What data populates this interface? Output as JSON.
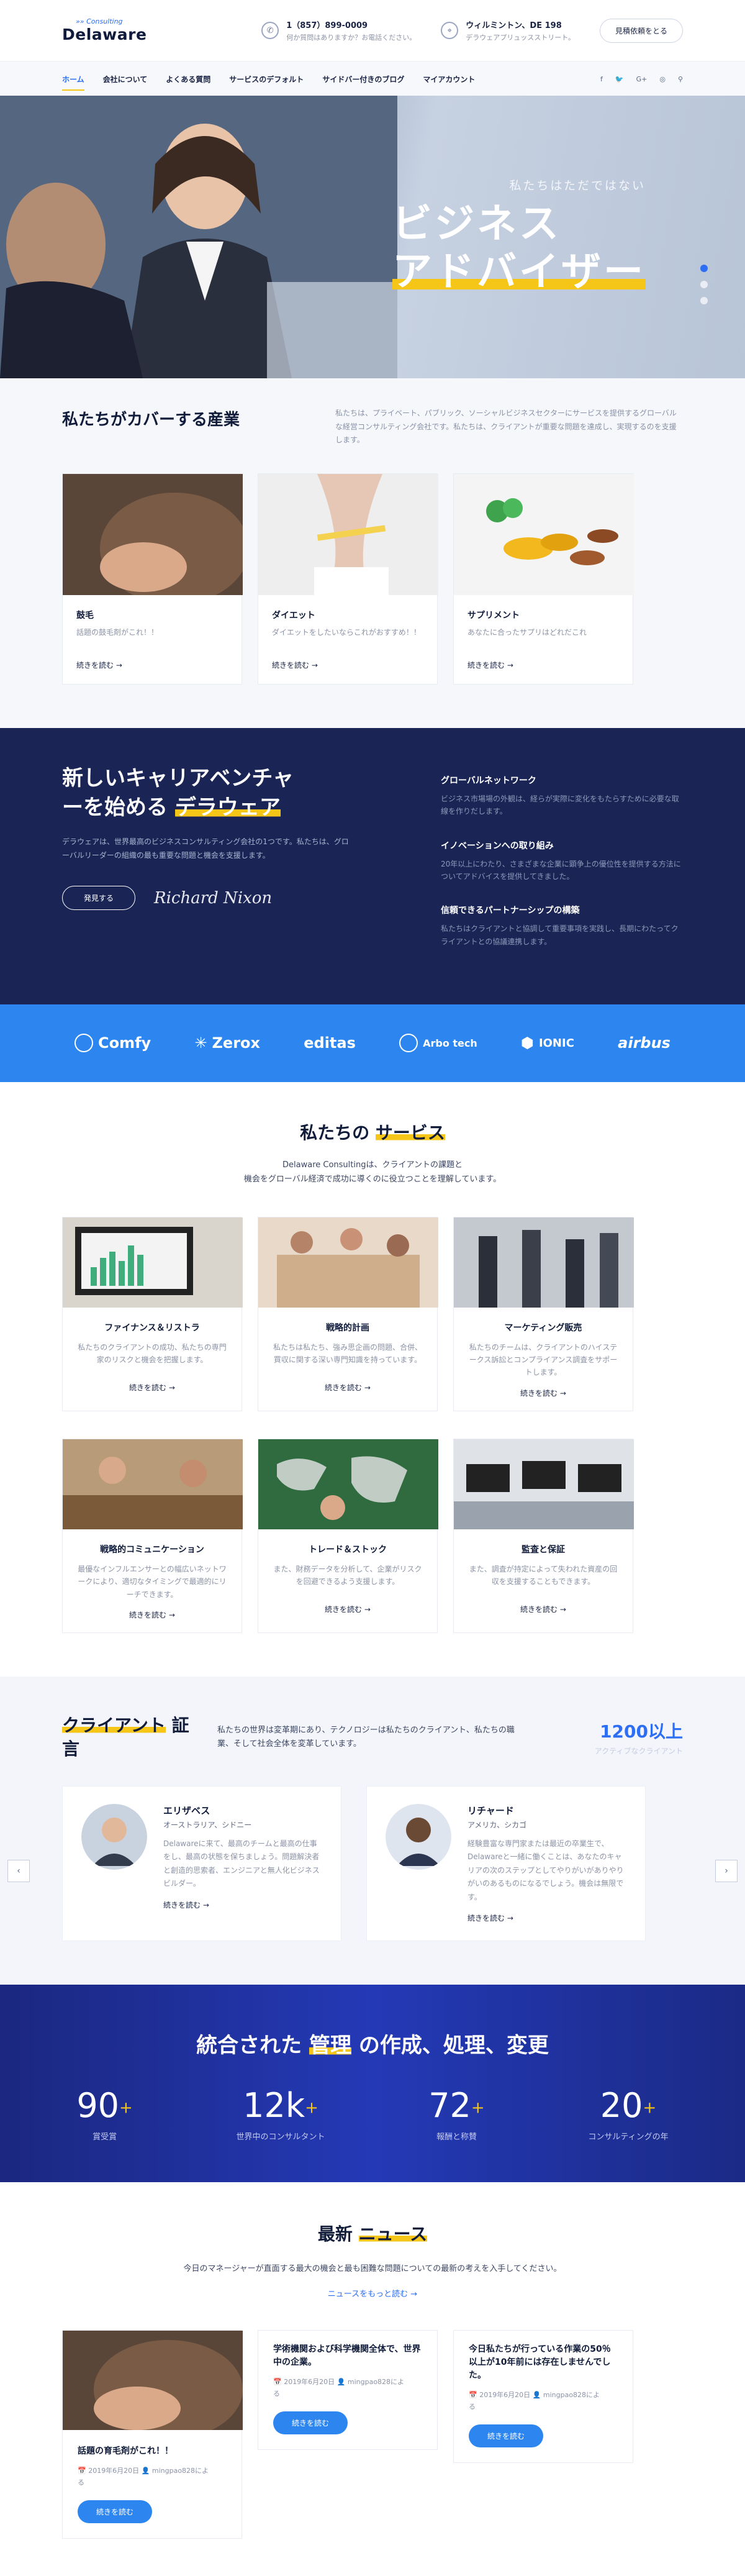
{
  "header": {
    "logo_small": "»» Consulting",
    "logo_big": "Delaware",
    "phone": "1（857）899-0009",
    "phone_sub": "何か質問はありますか？お電話ください。",
    "address": "ウィルミントン、DE 198",
    "address_sub": "デラウェアプリュッスストリート。",
    "quote_button": "見積依頼をとる"
  },
  "nav": {
    "items": [
      "ホーム",
      "会社について",
      "よくある質問",
      "サービスのデフォルト",
      "サイドバー付きのブログ",
      "マイアカウント"
    ],
    "socials": [
      "f",
      "🐦",
      "G+",
      "◎"
    ]
  },
  "hero": {
    "subtitle": "私たちはただではない",
    "title_line1": "ビジネス",
    "title_line2": "アドバイザー"
  },
  "industries": {
    "title": "私たちがカバーする産業",
    "description": "私たちは、プライベート、パブリック、ソーシャルビジネスセクターにサービスを提供するグローバルな経営コンサルティング会社です。私たちは、クライアントが重要な問題を達成し、実現するのを支援します。",
    "cards": [
      {
        "title": "鼓毛",
        "desc": "話題の鼓毛剤がこれ！！",
        "more": "続きを読む"
      },
      {
        "title": "ダイエット",
        "desc": "ダイエットをしたいならこれがおすすめ！！",
        "more": "続きを読む"
      },
      {
        "title": "サプリメント",
        "desc": "あなたに合ったサプリはどれだこれ",
        "more": "続きを読む"
      }
    ]
  },
  "career": {
    "title_a": "新しいキャリアベンチャ",
    "title_b": "ーを始める ",
    "title_hl": "デラウェア",
    "desc": "デラウェアは、世界最高のビジネスコンサルティング会社の1つです。私たちは、グローバルリーダーの組織の最も重要な問題と機会を支援します。",
    "button": "発見する",
    "signature": "Richard Nixon",
    "features": [
      {
        "title": "グローバルネットワーク",
        "desc": "ビジネス市場場の外観は、経らが実際に変化をもたらすために必要な取線を作りだします。"
      },
      {
        "title": "イノベーションへの取り組み",
        "desc": "20年以上にわたり、さまざまな企業に顕争上の優位性を提供する方法についてアドバイスを提供してきました。"
      },
      {
        "title": "信頼できるパートナーシップの構築",
        "desc": "私たちはクライアントと協調して重要事項を実践し、長期にわたってクライアントとの協議連携します。"
      }
    ]
  },
  "brands": [
    "Comfy",
    "Zerox",
    "editas",
    "Arbo tech",
    "IONIC",
    "airbus"
  ],
  "services": {
    "title_a": "私たちの ",
    "title_hl": "サービス",
    "lead1": "Delaware Consultingは、クライアントの課題と",
    "lead2": "機会をグローバル経済で成功に導くのに役立つことを理解しています。",
    "cards": [
      {
        "title": "ファイナンス＆リストラ",
        "desc": "私たちのクライアントの成功、私たちの専門家のリスクと機会を把握します。",
        "more": "続きを読む"
      },
      {
        "title": "戦略的計画",
        "desc": "私たちは私たち、強み思企画の問題、合併、買収に関する深い専門知識を持っています。",
        "more": "続きを読む"
      },
      {
        "title": "マーケティング販売",
        "desc": "私たちのチームは、クライアントのハイステークス訴訟とコンプライアンス調査をサポートします。",
        "more": "続きを読む"
      },
      {
        "title": "戦略的コミュニケーション",
        "desc": "最優なインフルエンサーとの幅広いネットワークにより、適切なタイミングで最適的にリーチできます。",
        "more": "続きを読む"
      },
      {
        "title": "トレード＆ストック",
        "desc": "また、財務データを分析して、企業がリスクを回避できるよう支援します。",
        "more": "続きを読む"
      },
      {
        "title": "監査と保証",
        "desc": "また、調査が持定によって失われた資産の回収を支援することもできます。",
        "more": "続きを読む"
      }
    ]
  },
  "testimonials": {
    "title_hl": "クライアント",
    "title_rest": " 証言",
    "lead": "私たちの世界は変革期にあり、テクノロジーは私たちのクライアント、私たちの職業、そして社会全体を変革しています。",
    "count": "1200以上",
    "count_label": "アクティブなクライアント",
    "items": [
      {
        "name": "エリザベス",
        "loc": "オーストラリア、シドニー",
        "text": "Delawareに来て、最高のチームと最高の仕事をし、最高の状態を保ちましょう。問題解決者と創造的思索者、エンジニアと無人化ビジネスビルダー。",
        "more": "続きを読む"
      },
      {
        "name": "リチャード",
        "loc": "アメリカ、シカゴ",
        "text": "経験豊富な専門家または最近の卒業生で、Delawareと一緒に働くことは、あなたのキャリアの次のステップとしてやりがいがありやりがいのあるものになるでしょう。機会は無限です。",
        "more": "続きを読む"
      }
    ]
  },
  "stats": {
    "title_a": "統合された ",
    "title_hl": "管理",
    "title_b": " の作成、処理、変更",
    "items": [
      {
        "num": "90",
        "plus": "+",
        "label": "賞受賞"
      },
      {
        "num": "12k",
        "plus": "+",
        "label": "世界中のコンサルタント"
      },
      {
        "num": "72",
        "plus": "+",
        "label": "報酬と称賛"
      },
      {
        "num": "20",
        "plus": "+",
        "label": "コンサルティングの年"
      }
    ]
  },
  "news": {
    "title_a": "最新 ",
    "title_hl": "ニュース",
    "lead": "今日のマネージャーが直面する最大の機会と最も困難な問題についての最新の考えを入手してください。",
    "all": "ニュースをもっと読む →",
    "items": [
      {
        "title": "話題の育毛剤がこれ！！",
        "meta1": "📅 2019年6月20日  👤 mingpao828によ",
        "meta2": "る",
        "btn": "続きを読む"
      },
      {
        "title": "学術機関および科学機関全体で、世界中の企業。",
        "meta1": "📅 2019年6月20日  👤 mingpao828によ",
        "meta2": "る",
        "btn": "続きを読む"
      },
      {
        "title": "今日私たちが行っている作業の50％以上が10年前には存在しませんでした。",
        "meta1": "📅 2019年6月20日  👤 mingpao828によ",
        "meta2": "る",
        "btn": "続きを読む"
      }
    ]
  }
}
